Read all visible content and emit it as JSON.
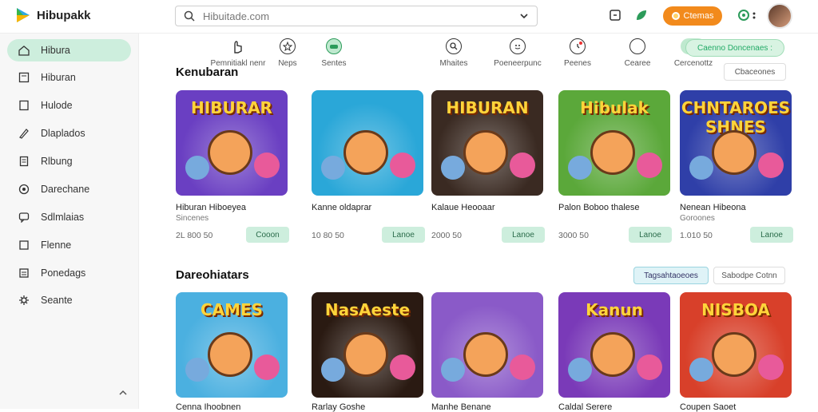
{
  "app": {
    "name": "Hibupakk"
  },
  "search": {
    "value": "Hibuitade.com"
  },
  "header": {
    "coins_label": "Ctemas"
  },
  "sidebar": {
    "items": [
      {
        "label": "Hibura",
        "icon": "home-icon",
        "active": true
      },
      {
        "label": "Hiburan",
        "icon": "bookmark-icon"
      },
      {
        "label": "Hulode",
        "icon": "square-icon"
      },
      {
        "label": "Dlaplados",
        "icon": "pencil-icon"
      },
      {
        "label": "Rlbung",
        "icon": "document-icon"
      },
      {
        "label": "Darechane",
        "icon": "circle-icon"
      },
      {
        "label": "Sdlmlaias",
        "icon": "chat-icon"
      },
      {
        "label": "Flenne",
        "icon": "box-icon"
      },
      {
        "label": "Ponedags",
        "icon": "list-icon"
      },
      {
        "label": "Seante",
        "icon": "gear-icon"
      }
    ]
  },
  "categories": [
    {
      "label": "Pemnitiakl nenr",
      "icon": "hand-icon"
    },
    {
      "label": "Neps",
      "icon": "star-icon"
    },
    {
      "label": "Sentes",
      "icon": "game-icon",
      "active": true
    },
    {
      "label": "Mhaites",
      "icon": "search-icon"
    },
    {
      "label": "Poeneerpunc",
      "icon": "smile-icon"
    },
    {
      "label": "Peenes",
      "icon": "alarm-icon"
    },
    {
      "label": "Cearee",
      "icon": "chat-icon"
    },
    {
      "label": "Cercenottz",
      "icon": "toggle-icon"
    }
  ],
  "category_pill": "Caenno Doncenaes :",
  "section1": {
    "title": "Kenubaran",
    "action": "Cbaceones",
    "cards": [
      {
        "thumb_text": "HIBURAR",
        "title": "Hiburan Hiboeyea",
        "sub": "Sincenes",
        "price": "2L 800 50",
        "button": "Cooon",
        "bg": "#6a3fc2"
      },
      {
        "thumb_text": "",
        "title": "Kanne oldaprar",
        "sub": "",
        "price": "10 80 50",
        "button": "Lanoe",
        "bg": "#2aa7d8"
      },
      {
        "thumb_text": "HIBURAN",
        "title": "Kalaue Heooaar",
        "sub": "",
        "price": "2000 50",
        "button": "Lanoe",
        "bg": "#3a2a22"
      },
      {
        "thumb_text": "Hibulak",
        "title": "Palon Boboo thalese",
        "sub": "",
        "price": "3000 50",
        "button": "Lanoe",
        "bg": "#5ba83a"
      },
      {
        "thumb_text": "CHNTAROES SHNES",
        "title": "Nenean Hibeona",
        "sub": "Goroones",
        "price": "1.010 50",
        "button": "Lanoe",
        "bg": "#2f3fa8"
      }
    ]
  },
  "section2": {
    "title": "Dareohiatars",
    "action_primary": "Tagsahtaoeoes",
    "action_secondary": "Sabodpe Cotnn",
    "cards": [
      {
        "thumb_text": "CAMES",
        "title": "Cenna Ihoobnen",
        "bg": "#4bb0e0"
      },
      {
        "thumb_text": "NasAeste",
        "title": "Rarlay Goshe",
        "bg": "#2a1a12"
      },
      {
        "thumb_text": "",
        "title": "Manhe Benane",
        "bg": "#8a5ac8"
      },
      {
        "thumb_text": "Kanun",
        "title": "Caldal Serere",
        "bg": "#7a3ab8"
      },
      {
        "thumb_text": "NISBOA",
        "title": "Coupen Saoet",
        "bg": "#d8402a"
      }
    ]
  }
}
